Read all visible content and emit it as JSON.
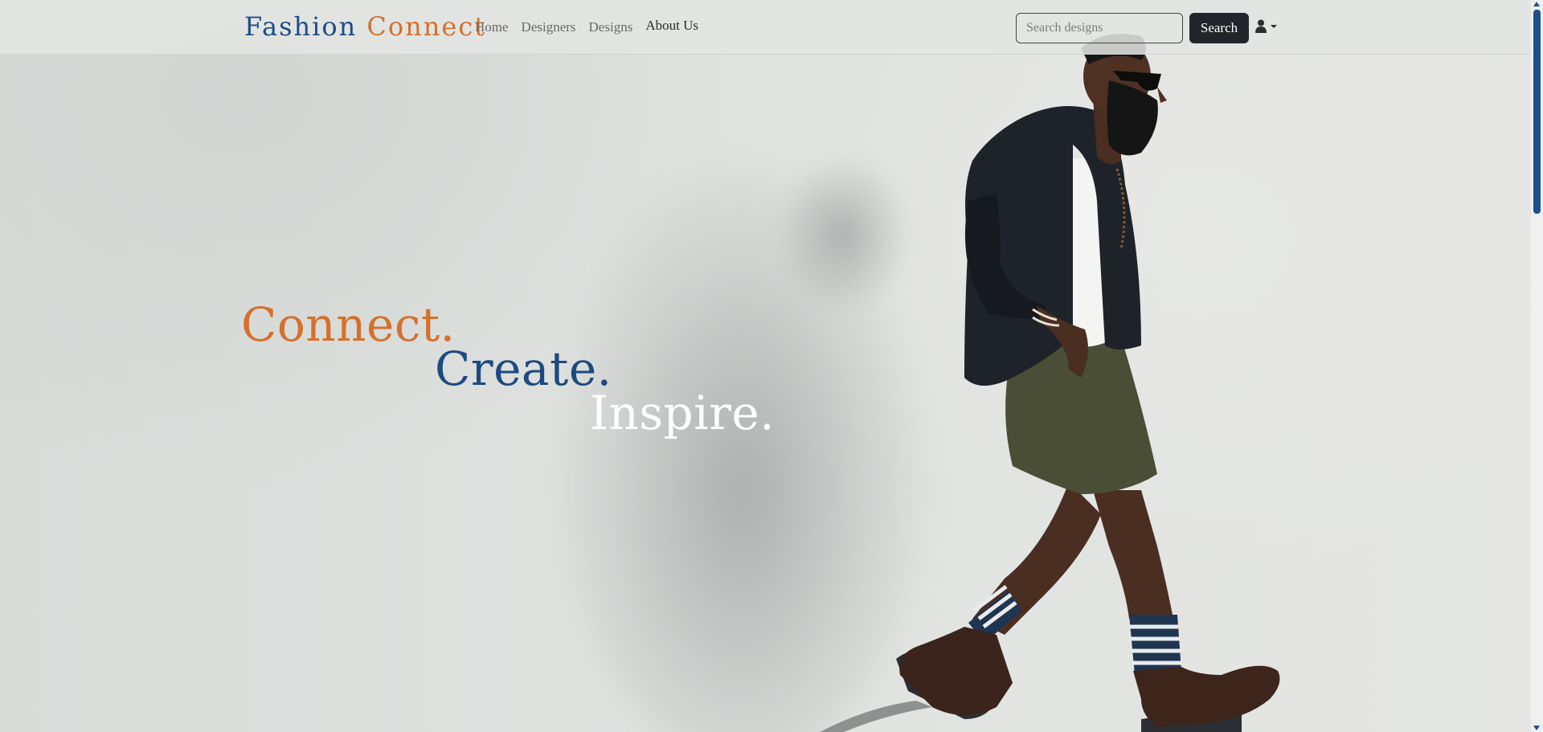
{
  "brand": {
    "part1": "Fashion",
    "part2": "Connect"
  },
  "nav": {
    "links": [
      {
        "label": "Home"
      },
      {
        "label": "Designers"
      },
      {
        "label": "Designs"
      },
      {
        "label": "About Us"
      }
    ]
  },
  "search": {
    "placeholder": "Search designs",
    "button_label": "Search"
  },
  "user_menu": {
    "icon": "user-icon",
    "caret": "caret-down-icon"
  },
  "hero": {
    "line1": "Connect.",
    "line2": "Create.",
    "line3": "Inspire."
  },
  "colors": {
    "brand_blue": "#1e4d86",
    "brand_orange": "#d4702b",
    "dark_button": "#212529",
    "hero_white": "#ffffff"
  }
}
